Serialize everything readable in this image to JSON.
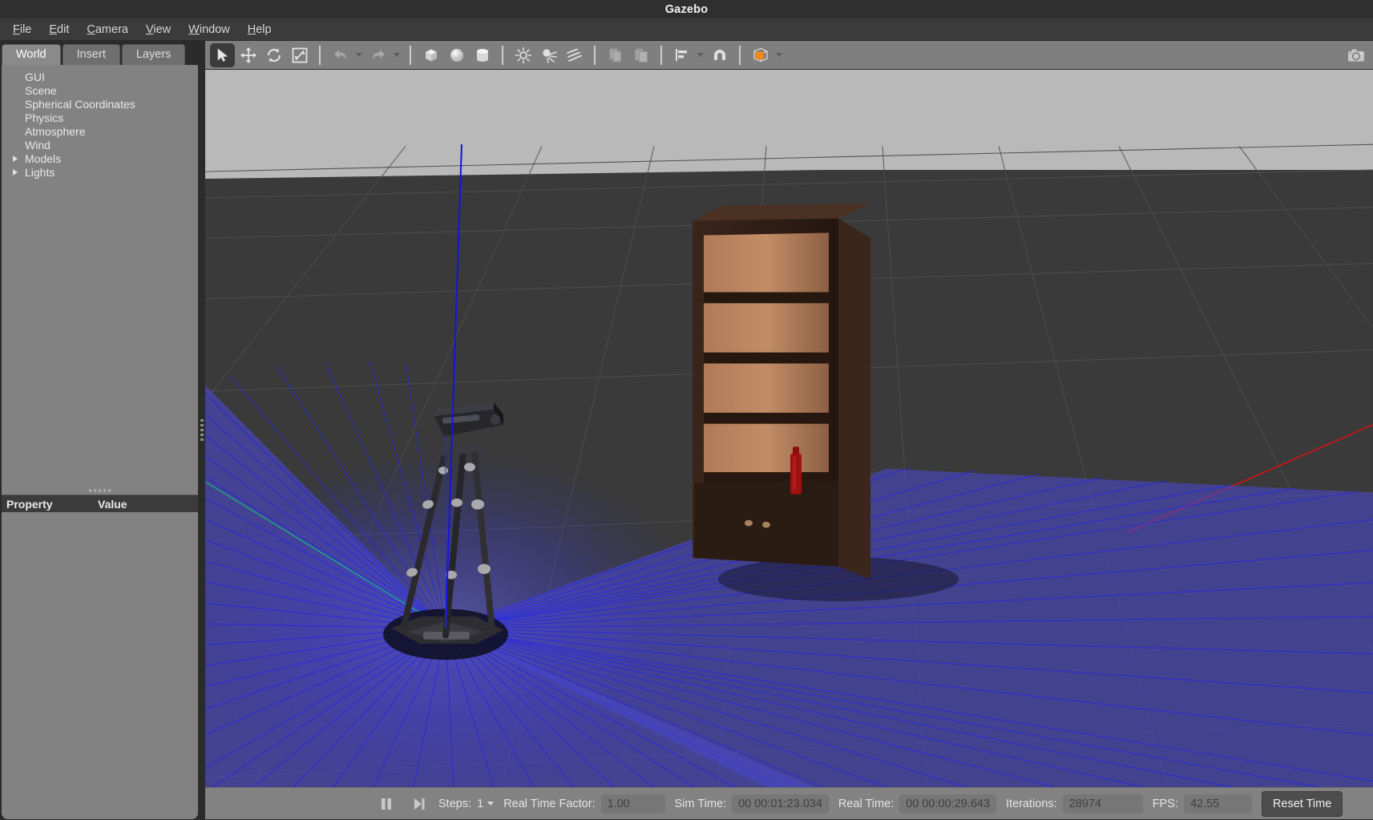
{
  "window": {
    "title": "Gazebo"
  },
  "menu": {
    "items": [
      {
        "label": "File",
        "mnemonic": "F"
      },
      {
        "label": "Edit",
        "mnemonic": "E"
      },
      {
        "label": "Camera",
        "mnemonic": "C"
      },
      {
        "label": "View",
        "mnemonic": "V"
      },
      {
        "label": "Window",
        "mnemonic": "W"
      },
      {
        "label": "Help",
        "mnemonic": "H"
      }
    ]
  },
  "left_panel": {
    "tabs": [
      {
        "label": "World",
        "active": true
      },
      {
        "label": "Insert",
        "active": false
      },
      {
        "label": "Layers",
        "active": false
      }
    ],
    "tree": [
      {
        "label": "GUI",
        "expandable": false
      },
      {
        "label": "Scene",
        "expandable": false
      },
      {
        "label": "Spherical Coordinates",
        "expandable": false
      },
      {
        "label": "Physics",
        "expandable": false
      },
      {
        "label": "Atmosphere",
        "expandable": false
      },
      {
        "label": "Wind",
        "expandable": false
      },
      {
        "label": "Models",
        "expandable": true
      },
      {
        "label": "Lights",
        "expandable": true
      }
    ],
    "property_table": {
      "columns": [
        "Property",
        "Value"
      ],
      "rows": []
    }
  },
  "toolbar": {
    "buttons": [
      {
        "name": "select-mode",
        "icon": "cursor-arrow-icon",
        "active": true
      },
      {
        "name": "translate-mode",
        "icon": "move-arrows-icon",
        "active": false
      },
      {
        "name": "rotate-mode",
        "icon": "rotate-icon",
        "active": false
      },
      {
        "name": "scale-mode",
        "icon": "scale-icon",
        "active": false
      },
      {
        "name": "undo",
        "icon": "undo-arrow-icon",
        "active": false,
        "disabled": true
      },
      {
        "name": "redo",
        "icon": "redo-arrow-icon",
        "active": false,
        "disabled": true
      },
      {
        "name": "insert-box",
        "icon": "box-icon",
        "active": false
      },
      {
        "name": "insert-sphere",
        "icon": "sphere-icon",
        "active": false
      },
      {
        "name": "insert-cylinder",
        "icon": "cylinder-icon",
        "active": false
      },
      {
        "name": "insert-point-light",
        "icon": "point-light-icon",
        "active": false
      },
      {
        "name": "insert-spot-light",
        "icon": "spot-light-icon",
        "active": false
      },
      {
        "name": "insert-directional-light",
        "icon": "directional-light-icon",
        "active": false
      },
      {
        "name": "copy",
        "icon": "copy-icon",
        "active": false,
        "disabled": true
      },
      {
        "name": "paste",
        "icon": "paste-icon",
        "active": false,
        "disabled": true
      },
      {
        "name": "align",
        "icon": "align-icon",
        "active": false
      },
      {
        "name": "snap",
        "icon": "magnet-snap-icon",
        "active": false
      },
      {
        "name": "view-color",
        "icon": "view-cube-orange-icon",
        "active": false
      },
      {
        "name": "screenshot",
        "icon": "camera-icon",
        "active": false
      }
    ],
    "accent_orange": "#f0861e"
  },
  "scene": {
    "sky_color": "#b9b9b9",
    "ground_color": "#3a3a3a",
    "grid_color": "#545454",
    "laser_color": "#2a2ae0",
    "laser_fill": "#4a47c8",
    "axis_x_color": "#cc1111",
    "axis_y_color": "#11aa77",
    "axis_z_color": "#1111dd",
    "objects": [
      {
        "name": "laser-scanner-tripod-robot",
        "type": "model"
      },
      {
        "name": "bookshelf",
        "type": "model",
        "shelves": 4
      },
      {
        "name": "red-bottle",
        "type": "model",
        "color": "#9e1111"
      }
    ]
  },
  "status_bar": {
    "pause_icon": "pause-icon",
    "step_icon": "step-forward-icon",
    "steps_label": "Steps:",
    "steps_value": "1",
    "real_time_factor_label": "Real Time Factor:",
    "real_time_factor_value": "1.00",
    "sim_time_label": "Sim Time:",
    "sim_time_value": "00 00:01:23.034",
    "real_time_label": "Real Time:",
    "real_time_value": "00 00:00:29.643",
    "iterations_label": "Iterations:",
    "iterations_value": "28974",
    "fps_label": "FPS:",
    "fps_value": "42.55",
    "reset_time_label": "Reset Time"
  }
}
